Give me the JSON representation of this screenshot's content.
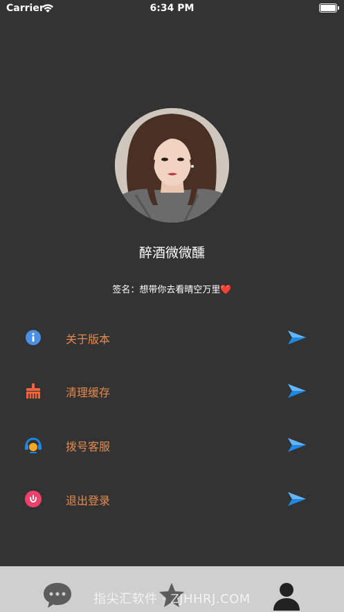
{
  "status_bar": {
    "carrier": "Carrier",
    "time": "6:34 PM"
  },
  "profile": {
    "nickname": "醉酒微微醺",
    "signature": "签名：想带你去看晴空万里",
    "signature_emoji": "❤️"
  },
  "menu": [
    {
      "label": "关于版本",
      "icon": "info-icon",
      "color": "#4a90e2"
    },
    {
      "label": "清理缓存",
      "icon": "broom-icon",
      "color": "#f2643c"
    },
    {
      "label": "拨号客服",
      "icon": "headset-icon",
      "color": "#1e88e5"
    },
    {
      "label": "退出登录",
      "icon": "logout-icon",
      "color": "#f0416a"
    }
  ],
  "tab_bar": {
    "tabs": [
      {
        "icon": "chat-bubble-icon"
      },
      {
        "icon": "star-icon"
      },
      {
        "icon": "person-icon"
      }
    ]
  },
  "watermark": "指尖汇软件 · ZJHHRJ.COM",
  "colors": {
    "background": "#333333",
    "menu_label": "#e58a4e",
    "tab_bar": "#cfcfcf",
    "arrow": "#1e88e5"
  }
}
